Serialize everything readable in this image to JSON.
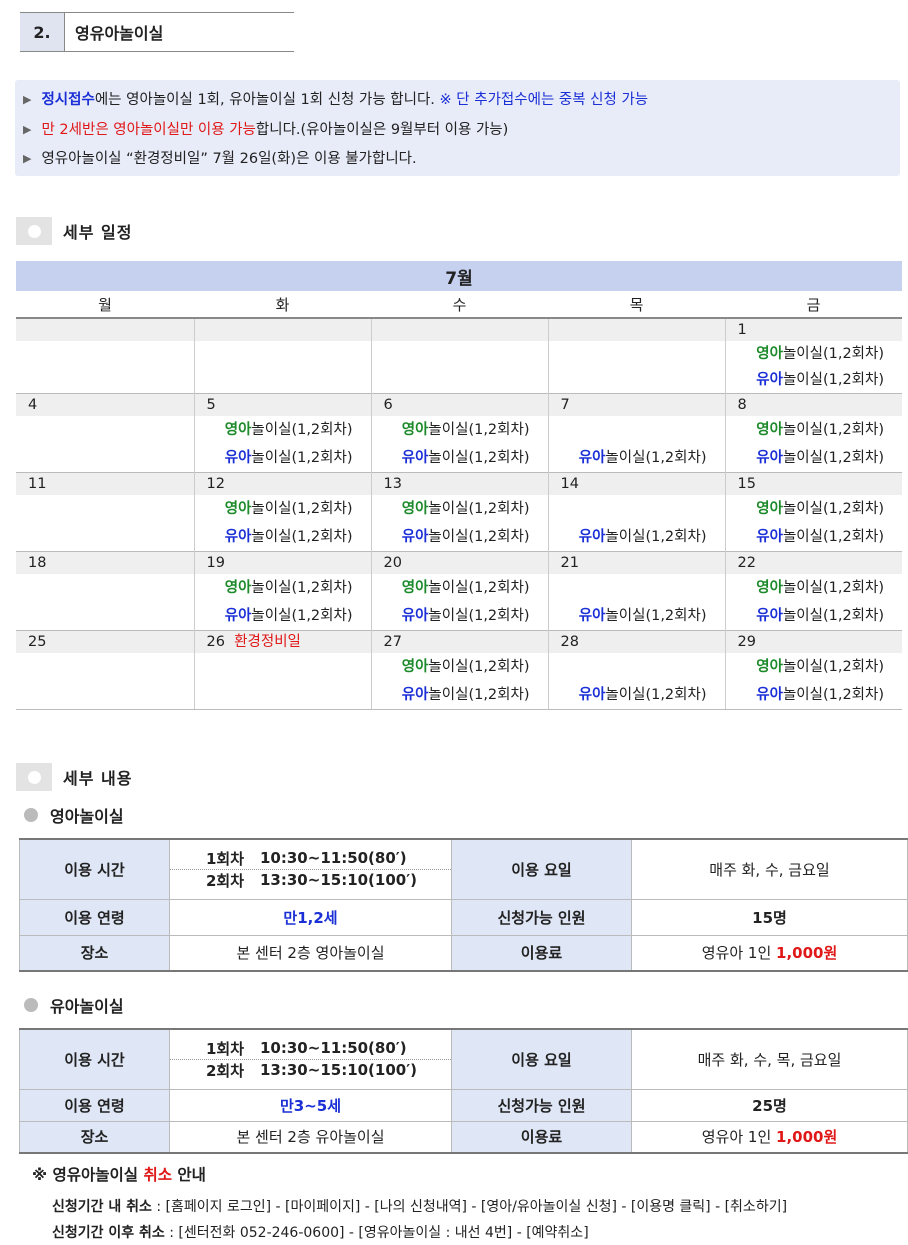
{
  "section": {
    "number": "2.",
    "title": "영유아놀이실"
  },
  "notice": {
    "line1": {
      "a": "정시접수",
      "b": "에는 영아놀이실 1회, 유아놀이실 1회 신청 가능 합니다. ",
      "c": "※ 단 추가접수에는 중복 신청 가능"
    },
    "line2": {
      "a": "만 2세반은 영아놀이실만 이용 가능",
      "b": "합니다.(유아놀이실은 9월부터 이용 가능)"
    },
    "line3": "영유아놀이실 “환경정비일” 7월 26일(화)은 이용 불가합니다."
  },
  "schedule_header": "세부 일정",
  "calendar": {
    "month": "7월",
    "days": [
      "월",
      "화",
      "수",
      "목",
      "금"
    ],
    "infant_prefix": "영아",
    "toddler_prefix": "유아",
    "room_suffix": "놀이실(1,2회차)",
    "closed_label": "환경정비일",
    "weeks": [
      {
        "dates": [
          "",
          "",
          "",
          "",
          "1"
        ]
      },
      {
        "dates": [
          "4",
          "5",
          "6",
          "7",
          "8"
        ]
      },
      {
        "dates": [
          "11",
          "12",
          "13",
          "14",
          "15"
        ]
      },
      {
        "dates": [
          "18",
          "19",
          "20",
          "21",
          "22"
        ]
      },
      {
        "dates": [
          "25",
          "26",
          "27",
          "28",
          "29"
        ]
      }
    ]
  },
  "details_header": "세부 내용",
  "infant": {
    "title": "영아놀이실",
    "time_label": "이용 시간",
    "s1_name": "1회차",
    "s1_time": "10:30~11:50(80′)",
    "s2_name": "2회차",
    "s2_time": "13:30~15:10(100′)",
    "day_label": "이용 요일",
    "days": "매주 화, 수, 금요일",
    "age_label": "이용 연령",
    "age": "만1,2세",
    "cap_label": "신청가능 인원",
    "cap": "15명",
    "place_label": "장소",
    "place": "본 센터 2층 영아놀이실",
    "fee_label": "이용료",
    "fee_prefix": "영유아 1인 ",
    "fee": "1,000원"
  },
  "toddler": {
    "title": "유아놀이실",
    "time_label": "이용 시간",
    "s1_name": "1회차",
    "s1_time": "10:30~11:50(80′)",
    "s2_name": "2회차",
    "s2_time": "13:30~15:10(100′)",
    "day_label": "이용 요일",
    "days": "매주 화, 수, 목, 금요일",
    "age_label": "이용 연령",
    "age": "만3~5세",
    "cap_label": "신청가능 인원",
    "cap": "25명",
    "place_label": "장소",
    "place": "본 센터 2층 유아놀이실",
    "fee_label": "이용료",
    "fee_prefix": "영유아 1인 ",
    "fee": "1,000원"
  },
  "cancel": {
    "mark": "※",
    "title_a": "영유아놀이실 ",
    "title_b": "취소",
    "title_c": " 안내",
    "l1_label": "신청기간 내 취소",
    "l1_text": " : [홈페이지 로그인] - [마이페이지] - [나의 신청내역] - [영아/유아놀이실 신청] - [이용명 클릭] - [취소하기]",
    "l2_label": "신청기간 이후 취소",
    "l2_text": " : [센터전화 052-246-0600] - [영유아놀이실 : 내선 4번] - [예약취소]"
  }
}
